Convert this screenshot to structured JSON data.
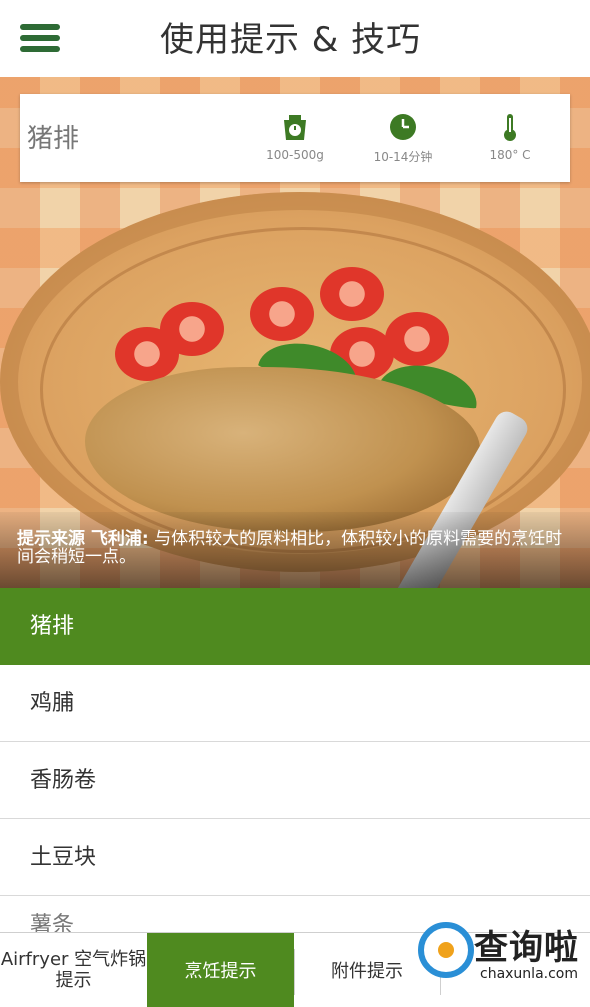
{
  "header": {
    "title": "使用提示 & 技巧"
  },
  "info": {
    "name": "猪排",
    "weight": "100-500g",
    "time": "10-14分钟",
    "temperature": "180° C"
  },
  "caption": {
    "source_label": "提示来源 飞利浦:",
    "text": "与体积较大的原料相比，体积较小的原料需要的烹饪时间会稍短一点。"
  },
  "foods": [
    "猪排",
    "鸡脯",
    "香肠卷",
    "土豆块",
    "薯条"
  ],
  "tabs": {
    "t1": "Airfryer 空气炸锅提示",
    "t2": "烹饪提示",
    "t3": "附件提示",
    "t4": ""
  },
  "watermark": {
    "cn": "查询啦",
    "en": "chaxunla.com"
  },
  "colors": {
    "accent_green": "#4f8a1f",
    "menu_green": "#2e6b35"
  }
}
